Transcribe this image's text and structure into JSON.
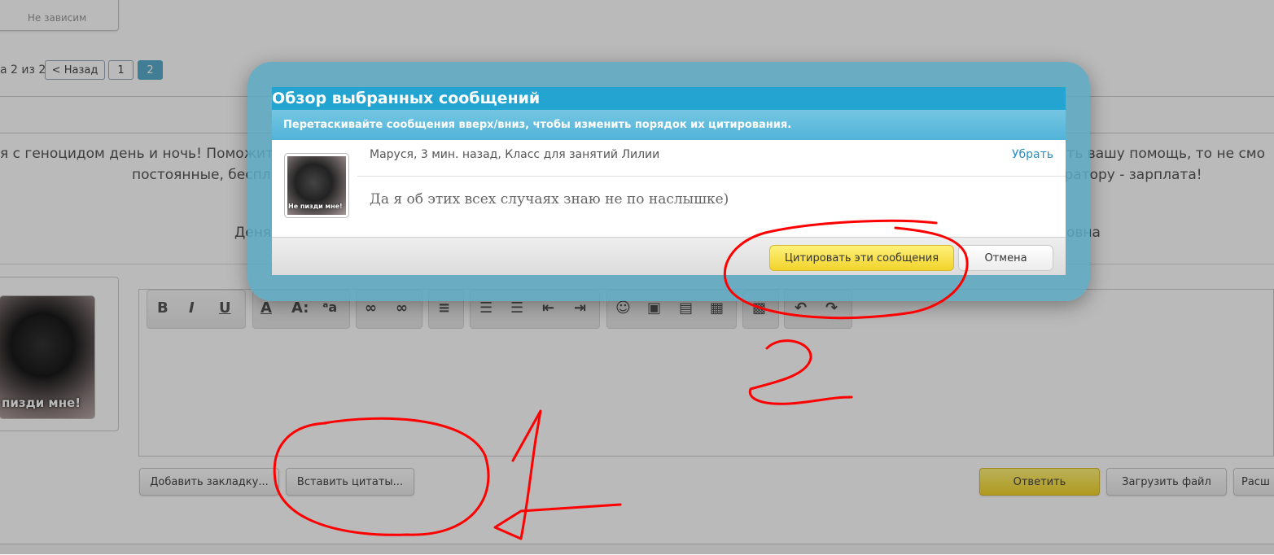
{
  "background": {
    "top_status": "Не зависим",
    "pagination": {
      "prefix": "а 2 из 2",
      "prev_label": "< Назад",
      "pages": [
        "1",
        "2"
      ],
      "current_page": "2"
    },
    "post_text": {
      "line1_left": "я с геноцидом день и ночь! Поможит",
      "line1_right": "ать вашу помощь, то не смо",
      "line2_left": "постоянные, беспл",
      "line2_right": "ератору - зарплата!",
      "line3_left": "Деня",
      "line3_right": "овна"
    },
    "avatar_caption": "пизди мне!",
    "editor_buttons": {
      "add_bookmark": "Добавить закладку...",
      "insert_quotes": "Вставить цитаты...",
      "reply": "Ответить",
      "upload_file": "Загрузить файл",
      "extended": "Расш"
    }
  },
  "dialog": {
    "title": "Обзор выбранных сообщений",
    "subtitle": "Перетаскивайте сообщения вверх/вниз, чтобы изменить порядок их цитирования.",
    "message": {
      "meta": "Маруся, 3 мин. назад, Класс для занятий Лилии",
      "remove_label": "Убрать",
      "text": "Да я об этих всех случаях знаю не по наслышке)",
      "avatar_caption": "Не пизди мне!"
    },
    "quote_button": "Цитировать эти сообщения",
    "cancel_button": "Отмена"
  },
  "colors": {
    "dialog_title_bg": "#24a4d0",
    "dialog_frame": "#5caac4",
    "link": "#2a8ec0",
    "quote_button": "#f2d42c",
    "annotation": "#ff0000"
  }
}
